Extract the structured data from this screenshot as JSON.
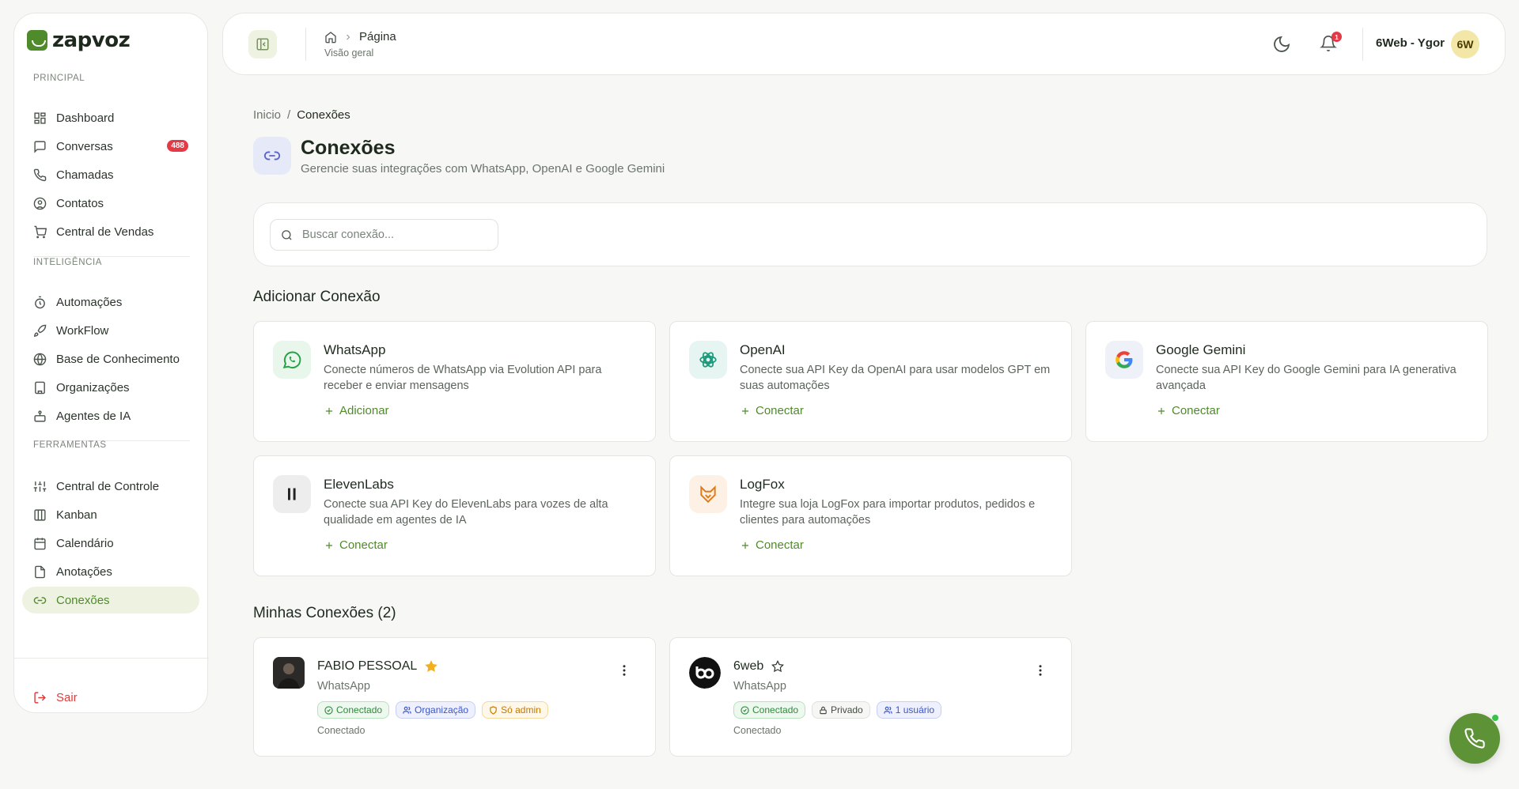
{
  "app": {
    "brand": "zapvoz",
    "accent": "#4f8a2b"
  },
  "sidebar": {
    "sections": [
      {
        "title": "PRINCIPAL",
        "items": [
          {
            "label": "Dashboard",
            "icon": "dashboard-icon"
          },
          {
            "label": "Conversas",
            "icon": "message-icon",
            "badge": "488"
          },
          {
            "label": "Chamadas",
            "icon": "phone-icon"
          },
          {
            "label": "Contatos",
            "icon": "contact-icon"
          },
          {
            "label": "Central de Vendas",
            "icon": "cart-icon"
          }
        ]
      },
      {
        "title": "INTELIGÊNCIA",
        "items": [
          {
            "label": "Automações",
            "icon": "timer-icon"
          },
          {
            "label": "WorkFlow",
            "icon": "rocket-icon"
          },
          {
            "label": "Base de Conhecimento",
            "icon": "globe-icon"
          },
          {
            "label": "Organizações",
            "icon": "building-icon"
          },
          {
            "label": "Agentes de IA",
            "icon": "bot-icon"
          }
        ]
      },
      {
        "title": "FERRAMENTAS",
        "items": [
          {
            "label": "Central de Controle",
            "icon": "sliders-icon"
          },
          {
            "label": "Kanban",
            "icon": "kanban-icon"
          },
          {
            "label": "Calendário",
            "icon": "calendar-icon"
          },
          {
            "label": "Anotações",
            "icon": "note-icon"
          },
          {
            "label": "Conexões",
            "icon": "link-icon",
            "active": true
          }
        ]
      }
    ],
    "logout": "Sair"
  },
  "topbar": {
    "breadcrumb": "Página",
    "subtitle": "Visão geral",
    "notifications": "1",
    "user_name": "6Web - Ygor",
    "user_initials": "6W"
  },
  "page": {
    "breadcrumb": {
      "home": "Inicio",
      "sep": "/",
      "current": "Conexões"
    },
    "title": "Conexões",
    "subtitle": "Gerencie suas integrações com WhatsApp, OpenAI e Google Gemini",
    "search_placeholder": "Buscar conexão...",
    "add_section_title": "Adicionar Conexão",
    "my_section_title": "Minhas Conexões (2)"
  },
  "providers": [
    {
      "name": "WhatsApp",
      "desc": "Conecte números de WhatsApp via Evolution API para receber e enviar mensagens",
      "action": "Adicionar",
      "icon": "whatsapp-icon"
    },
    {
      "name": "OpenAI",
      "desc": "Conecte sua API Key da OpenAI para usar modelos GPT em suas automações",
      "action": "Conectar",
      "icon": "openai-icon"
    },
    {
      "name": "Google Gemini",
      "desc": "Conecte sua API Key do Google Gemini para IA generativa avançada",
      "action": "Conectar",
      "icon": "google-icon"
    },
    {
      "name": "ElevenLabs",
      "desc": "Conecte sua API Key do ElevenLabs para vozes de alta qualidade em agentes de IA",
      "action": "Conectar",
      "icon": "elevenlabs-icon"
    },
    {
      "name": "LogFox",
      "desc": "Integre sua loja LogFox para importar produtos, pedidos e clientes para automações",
      "action": "Conectar",
      "icon": "logfox-icon"
    }
  ],
  "connections": [
    {
      "name": "FABIO PESSOAL",
      "type": "WhatsApp",
      "starred": true,
      "tags": [
        "Conectado",
        "Organização",
        "Só admin"
      ],
      "status": "Conectado"
    },
    {
      "name": "6web",
      "type": "WhatsApp",
      "starred": false,
      "tags": [
        "Conectado",
        "Privado",
        "1 usuário"
      ],
      "status": "Conectado"
    }
  ]
}
